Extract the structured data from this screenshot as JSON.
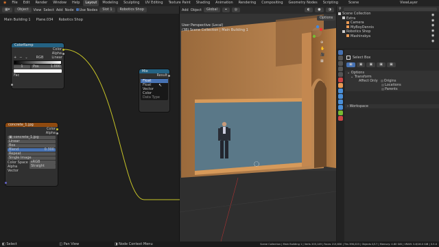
{
  "menu": [
    "File",
    "Edit",
    "Render",
    "Window",
    "Help"
  ],
  "workspaces": [
    "Layout",
    "Modeling",
    "Sculpting",
    "UV Editing",
    "Texture Paint",
    "Shading",
    "Animation",
    "Rendering",
    "Compositing",
    "Geometry Nodes",
    "Scripting"
  ],
  "scene_label": "Scene",
  "viewlayer_label": "ViewLayer",
  "node_editor": {
    "header": {
      "object_menu": "Object",
      "view": "View",
      "select": "Select",
      "add": "Add",
      "node": "Node",
      "use_nodes": "Use Nodes",
      "slot": "Slot 1",
      "material": "Robotics Shop"
    },
    "breadcrumbs": [
      "Main Building 1",
      "Plane.034",
      "Robotics Shop"
    ],
    "colorramp": {
      "title": "ColorRamp",
      "out_color": "Color",
      "out_alpha": "Alpha",
      "mode": "RGB",
      "interp": "Linear",
      "stop_index": "1",
      "stop_pos_label": "Pos",
      "stop_pos": "1.000",
      "fac": "Fac"
    },
    "mix": {
      "title": "Mix",
      "result": "Result",
      "options": [
        "Float",
        "Vector",
        "Color"
      ],
      "highlighted": "Float",
      "section": "Data Type"
    },
    "image": {
      "title": "concrete_1.jpg",
      "out_color": "Color",
      "out_alpha": "Alpha",
      "file": "concrete_1.jpg",
      "interp": "Linear",
      "proj": "Box",
      "blend_label": "Blend",
      "blend": "0.300",
      "extension": "Repeat",
      "source": "Single Image",
      "colorspace_label": "Color Space",
      "colorspace": "sRGB",
      "alpha_label": "Alpha",
      "alpha": "Straight",
      "vector": "Vector"
    }
  },
  "viewport": {
    "header": {
      "add": "Add",
      "object": "Object",
      "orientation": "Global"
    },
    "options": "Options",
    "info_line1": "User Perspective (Local)",
    "info_line2": "(38) Scene Collection | Main Building 1"
  },
  "outliner": {
    "items": [
      {
        "label": "Scene Collection",
        "indent": 0,
        "icon_color": "#cccccc"
      },
      {
        "label": "Extra",
        "indent": 1,
        "icon_color": "#cccccc"
      },
      {
        "label": "Camera",
        "indent": 2,
        "icon_color": "#ea9a54"
      },
      {
        "label": "MyBoyDennis",
        "indent": 2,
        "icon_color": "#ea9a54"
      },
      {
        "label": "Robotics Shop",
        "indent": 1,
        "icon_color": "#cccccc"
      },
      {
        "label": "Mashinskya",
        "indent": 2,
        "icon_color": "#ea9a54"
      }
    ]
  },
  "properties": {
    "tool": "Select Box",
    "options": "Options",
    "transform": "Transform",
    "affect_only": "Affect Only",
    "checks": [
      "Origins",
      "Locations",
      "Parents"
    ],
    "workspace": "Workspace"
  },
  "statusbar": {
    "left": "Select",
    "middle": "Pan View",
    "node_menu": "Node Context Menu",
    "stats": "Scene Collection | Main Building 1 | Verts 203,149 | Faces 213,630 | Tris 396,023 | Objects 0/17 | Memory: 4.80 GiB | VRAM: 3.8/16.0 GiB | 3.5.0"
  },
  "colors": {
    "accent": "#4772b3",
    "converter_header": "#246283",
    "image_header": "#8f4a0f",
    "wire": "#c7c427",
    "orange": "#ea9a54"
  }
}
